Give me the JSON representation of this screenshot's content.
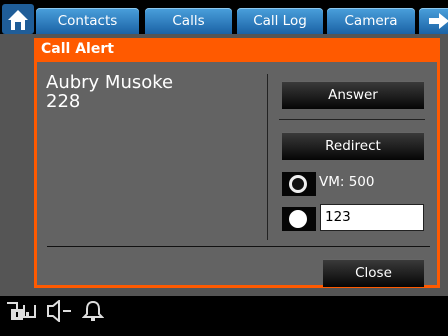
{
  "tabs": [
    {
      "label": "Contacts"
    },
    {
      "label": "Calls"
    },
    {
      "label": "Call Log"
    },
    {
      "label": "Camera"
    }
  ],
  "dialog": {
    "title": "Call Alert",
    "caller_name": "Aubry Musoke",
    "caller_number": "228",
    "answer_label": "Answer",
    "redirect_label": "Redirect",
    "vm_label": "VM: 500",
    "redirect_number_value": "123",
    "close_label": "Close"
  },
  "icons": {
    "home": "home-icon",
    "next": "arrow-right-icon",
    "lock": "lock-icon",
    "volume": "speaker-icon",
    "bell": "bell-icon"
  },
  "colors": {
    "accent": "#ff5a00",
    "tab": "#2f84c8",
    "panel": "#636363"
  }
}
